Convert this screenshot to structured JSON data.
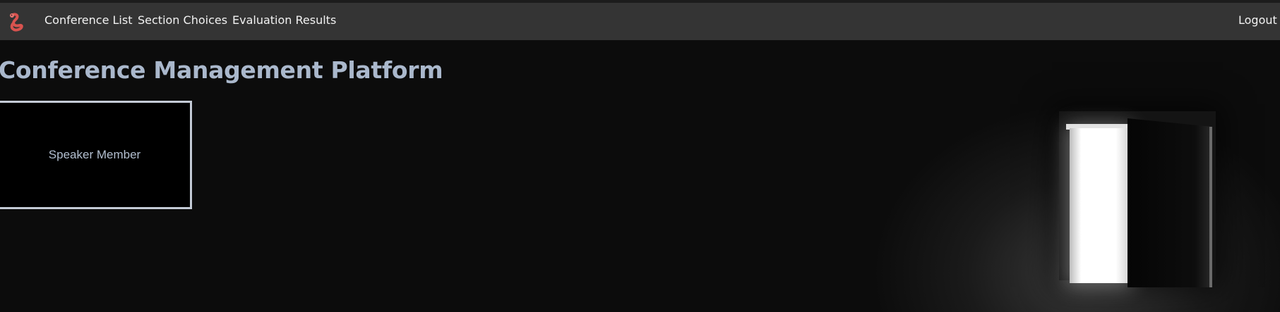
{
  "navbar": {
    "brand_icon": "worm-logo-icon",
    "links": [
      {
        "label": "Conference List"
      },
      {
        "label": "Section Choices"
      },
      {
        "label": "Evaluation Results"
      }
    ],
    "logout_label": "Logout"
  },
  "main": {
    "title": "Conference Management Platform",
    "role_card": {
      "label": "Speaker Member"
    }
  },
  "colors": {
    "navbar_bg": "#343434",
    "title": "#aab8cc",
    "card_border": "#c4cbd6",
    "brand_accent": "#d9534f"
  }
}
